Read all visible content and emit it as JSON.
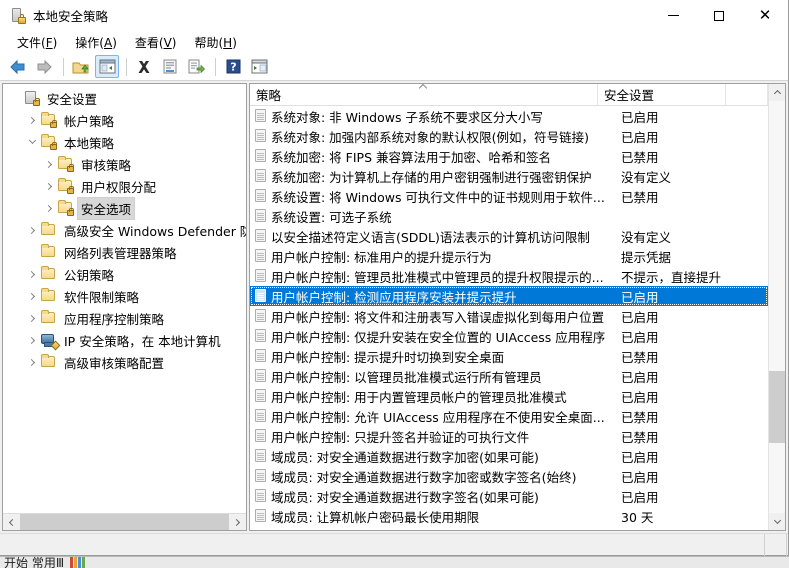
{
  "window": {
    "title": "本地安全策略",
    "icon": "security-policy-icon",
    "minimize_label": "最小化",
    "maximize_label": "最大化",
    "close_label": "关闭",
    "close_glyph": "✕"
  },
  "menu": {
    "items": [
      {
        "name": "file",
        "text": "文件(F)",
        "label": "文件(",
        "accel": "F",
        "tail": ")"
      },
      {
        "name": "action",
        "text": "操作(A)",
        "label": "操作(",
        "accel": "A",
        "tail": ")"
      },
      {
        "name": "view",
        "text": "查看(V)",
        "label": "查看(",
        "accel": "V",
        "tail": ")"
      },
      {
        "name": "help",
        "text": "帮助(H)",
        "label": "帮助(",
        "accel": "H",
        "tail": ")"
      }
    ]
  },
  "toolbar": {
    "buttons": [
      {
        "name": "back-button",
        "icon": "back-arrow-icon"
      },
      {
        "name": "forward-button",
        "icon": "forward-arrow-icon"
      },
      {
        "name": "up-folder-button",
        "icon": "folder-up-icon"
      },
      {
        "name": "show-hide-tree-button",
        "icon": "console-tree-icon",
        "pressed": true
      },
      {
        "name": "delete-button",
        "icon": "delete-x-icon"
      },
      {
        "name": "properties-button",
        "icon": "properties-icon"
      },
      {
        "name": "export-list-button",
        "icon": "export-list-icon"
      },
      {
        "name": "help-button",
        "icon": "help-question-icon"
      },
      {
        "name": "show-action-pane-button",
        "icon": "action-pane-icon"
      }
    ]
  },
  "tree": {
    "nodes": [
      {
        "label": "安全设置",
        "indent": 0,
        "twisty": "none",
        "icon": "security-settings-icon",
        "selected": false
      },
      {
        "label": "帐户策略",
        "indent": 1,
        "twisty": "right",
        "icon": "folder-lock-icon",
        "selected": false
      },
      {
        "label": "本地策略",
        "indent": 1,
        "twisty": "down",
        "icon": "folder-lock-icon",
        "selected": false
      },
      {
        "label": "审核策略",
        "indent": 2,
        "twisty": "right",
        "icon": "folder-lock-icon",
        "selected": false
      },
      {
        "label": "用户权限分配",
        "indent": 2,
        "twisty": "right",
        "icon": "folder-lock-icon",
        "selected": false
      },
      {
        "label": "安全选项",
        "indent": 2,
        "twisty": "right",
        "icon": "folder-lock-icon",
        "selected": true
      },
      {
        "label": "高级安全 Windows Defender 防火墙",
        "indent": 1,
        "twisty": "right",
        "icon": "folder-icon",
        "selected": false
      },
      {
        "label": "网络列表管理器策略",
        "indent": 1,
        "twisty": "none",
        "icon": "folder-icon",
        "selected": false
      },
      {
        "label": "公钥策略",
        "indent": 1,
        "twisty": "right",
        "icon": "folder-icon",
        "selected": false
      },
      {
        "label": "软件限制策略",
        "indent": 1,
        "twisty": "right",
        "icon": "folder-icon",
        "selected": false
      },
      {
        "label": "应用程序控制策略",
        "indent": 1,
        "twisty": "right",
        "icon": "folder-icon",
        "selected": false
      },
      {
        "label": "IP 安全策略，在 本地计算机",
        "indent": 1,
        "twisty": "right",
        "icon": "ip-security-icon",
        "selected": false
      },
      {
        "label": "高级审核策略配置",
        "indent": 1,
        "twisty": "right",
        "icon": "folder-icon",
        "selected": false
      }
    ],
    "hscroll": {
      "left_arrow": "◄",
      "right_arrow": "►"
    }
  },
  "list": {
    "columns": [
      {
        "name": "policy",
        "label": "策略",
        "sorted": "asc"
      },
      {
        "name": "setting",
        "label": "安全设置",
        "sorted": "none"
      }
    ],
    "rows": [
      {
        "policy": "系统对象: 非 Windows 子系统不要求区分大小写",
        "setting": "已启用",
        "selected": false
      },
      {
        "policy": "系统对象: 加强内部系统对象的默认权限(例如，符号链接)",
        "setting": "已启用",
        "selected": false
      },
      {
        "policy": "系统加密: 将 FIPS 兼容算法用于加密、哈希和签名",
        "setting": "已禁用",
        "selected": false
      },
      {
        "policy": "系统加密: 为计算机上存储的用户密钥强制进行强密钥保护",
        "setting": "没有定义",
        "selected": false
      },
      {
        "policy": "系统设置: 将 Windows 可执行文件中的证书规则用于软件...",
        "setting": "已禁用",
        "selected": false
      },
      {
        "policy": "系统设置: 可选子系统",
        "setting": "",
        "selected": false
      },
      {
        "policy": "以安全描述符定义语言(SDDL)语法表示的计算机访问限制",
        "setting": "没有定义",
        "selected": false
      },
      {
        "policy": "用户帐户控制: 标准用户的提升提示行为",
        "setting": "提示凭据",
        "selected": false
      },
      {
        "policy": "用户帐户控制: 管理员批准模式中管理员的提升权限提示的...",
        "setting": "不提示，直接提升",
        "selected": false
      },
      {
        "policy": "用户帐户控制: 检测应用程序安装并提示提升",
        "setting": "已启用",
        "selected": true
      },
      {
        "policy": "用户帐户控制: 将文件和注册表写入错误虚拟化到每用户位置",
        "setting": "已启用",
        "selected": false
      },
      {
        "policy": "用户帐户控制: 仅提升安装在安全位置的 UIAccess 应用程序",
        "setting": "已启用",
        "selected": false
      },
      {
        "policy": "用户帐户控制: 提示提升时切换到安全桌面",
        "setting": "已禁用",
        "selected": false
      },
      {
        "policy": "用户帐户控制: 以管理员批准模式运行所有管理员",
        "setting": "已启用",
        "selected": false
      },
      {
        "policy": "用户帐户控制: 用于内置管理员帐户的管理员批准模式",
        "setting": "已启用",
        "selected": false
      },
      {
        "policy": "用户帐户控制: 允许 UIAccess 应用程序在不使用安全桌面...",
        "setting": "已禁用",
        "selected": false
      },
      {
        "policy": "用户帐户控制: 只提升签名并验证的可执行文件",
        "setting": "已禁用",
        "selected": false
      },
      {
        "policy": "域成员: 对安全通道数据进行数字加密(如果可能)",
        "setting": "已启用",
        "selected": false
      },
      {
        "policy": "域成员: 对安全通道数据进行数字加密或数字签名(始终)",
        "setting": "已启用",
        "selected": false
      },
      {
        "policy": "域成员: 对安全通道数据进行数字签名(如果可能)",
        "setting": "已启用",
        "selected": false
      },
      {
        "policy": "域成员: 让算机帐户密码最长使用期限",
        "setting": "30 天",
        "selected": false
      }
    ],
    "vscroll": {
      "up_arrow": "▲",
      "down_arrow": "▼"
    }
  },
  "taskbar": {
    "text": "开始    常用Ⅲ"
  },
  "colors": {
    "selection": "#0078d7",
    "window_bg": "#ffffff",
    "chrome_bg": "#f0f0f0",
    "tree_selection": "#d8d8d8"
  }
}
